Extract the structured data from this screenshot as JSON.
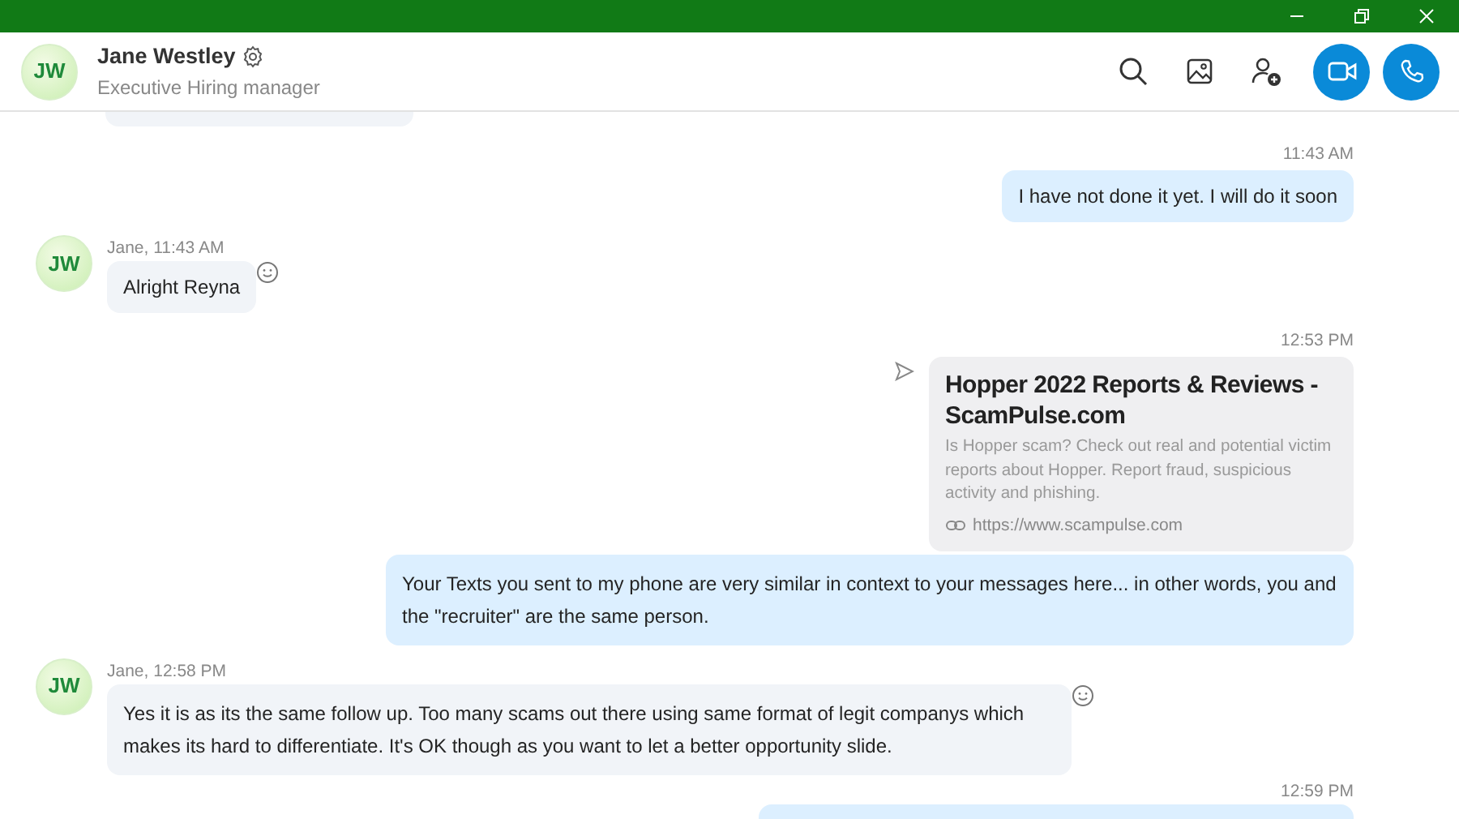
{
  "contact": {
    "initials": "JW",
    "name": "Jane Westley",
    "subtitle": "Executive Hiring manager"
  },
  "messages": [
    {
      "kind": "incoming_cut"
    },
    {
      "kind": "outgoing",
      "time": "11:43 AM",
      "text": "I have not done it yet. I will do it soon"
    },
    {
      "kind": "incoming",
      "initials": "JW",
      "meta": "Jane, 11:43 AM",
      "text": "Alright Reyna"
    },
    {
      "kind": "link",
      "time": "12:53 PM",
      "title": "Hopper 2022 Reports & Reviews - ScamPulse.com",
      "description": "Is Hopper scam? Check out real and potential victim reports about Hopper. Report fraud, suspicious activity and phishing.",
      "url": "https://www.scampulse.com"
    },
    {
      "kind": "outgoing",
      "text": "Your Texts you sent to my phone are very similar in context to your messages here... in other words, you and the \"recruiter\" are the same person."
    },
    {
      "kind": "incoming",
      "initials": "JW",
      "meta": "Jane, 12:58 PM",
      "text": "Yes it is as its the same follow up. Too many scams out there using same format of legit companys which makes its hard to differentiate. It's OK though as you want to let a better opportunity slide."
    },
    {
      "kind": "outgoing_cut",
      "time": "12:59 PM"
    }
  ]
}
